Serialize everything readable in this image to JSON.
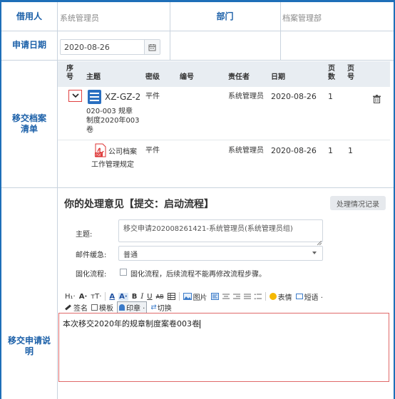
{
  "form": {
    "borrower_label": "借用人",
    "borrower_value": "系统管理员",
    "dept_label": "部门",
    "dept_value": "档案管理部",
    "date_label": "申请日期",
    "date_value": "2020-08-26",
    "list_label": "移交档案清单",
    "desc_label": "移交申请说明"
  },
  "grid": {
    "headers": {
      "seq": [
        "序",
        "号"
      ],
      "subject": "主题",
      "secret": "密级",
      "number": "编号",
      "owner": "责任者",
      "date": "日期",
      "pages": [
        "页",
        "数"
      ],
      "page_no": [
        "页",
        "号"
      ]
    },
    "rows": [
      {
        "subject": [
          "XZ-GZ-2",
          "020-003 规章",
          "制度2020年003",
          "卷"
        ],
        "secret": "平件",
        "number": "",
        "owner": "系统管理员",
        "date": "2020-08-26",
        "pages": "1",
        "page_no": ""
      },
      {
        "file_badge": "PDF",
        "subject": [
          "公司档案",
          "工作管理规定"
        ],
        "secret": "平件",
        "number": "",
        "owner": "系统管理员",
        "date": "2020-08-26",
        "pages": "1",
        "page_no": "1"
      }
    ]
  },
  "opinion": {
    "title": "你的处理意见【提交：启动流程】",
    "record_button": "处理情况记录",
    "subject_label": "主题:",
    "subject_value": "移交申请202008261421-系统管理员(系统管理员组)",
    "urgency_label": "邮件缓急:",
    "urgency_value": "普通",
    "fix_label": "固化流程:",
    "fix_text": "固化流程，后续流程不能再修改流程步骤。"
  },
  "toolbar": {
    "heading": "H₁·",
    "font": "A·",
    "size": "тT·",
    "bold": "B",
    "italic": "I",
    "underline": "U",
    "strike": "AB",
    "image": "图片",
    "emoji": "表情",
    "phrase": "短语 ·",
    "sign": "签名",
    "template": "模板",
    "stamp": "印章 ·",
    "switch": "切换"
  },
  "editor": {
    "content": "本次移交2020年的规章制度案卷003卷"
  },
  "colors": {
    "frame": "#1e6fb8",
    "label": "#1a5fa8",
    "highlight_border": "#e04040"
  }
}
